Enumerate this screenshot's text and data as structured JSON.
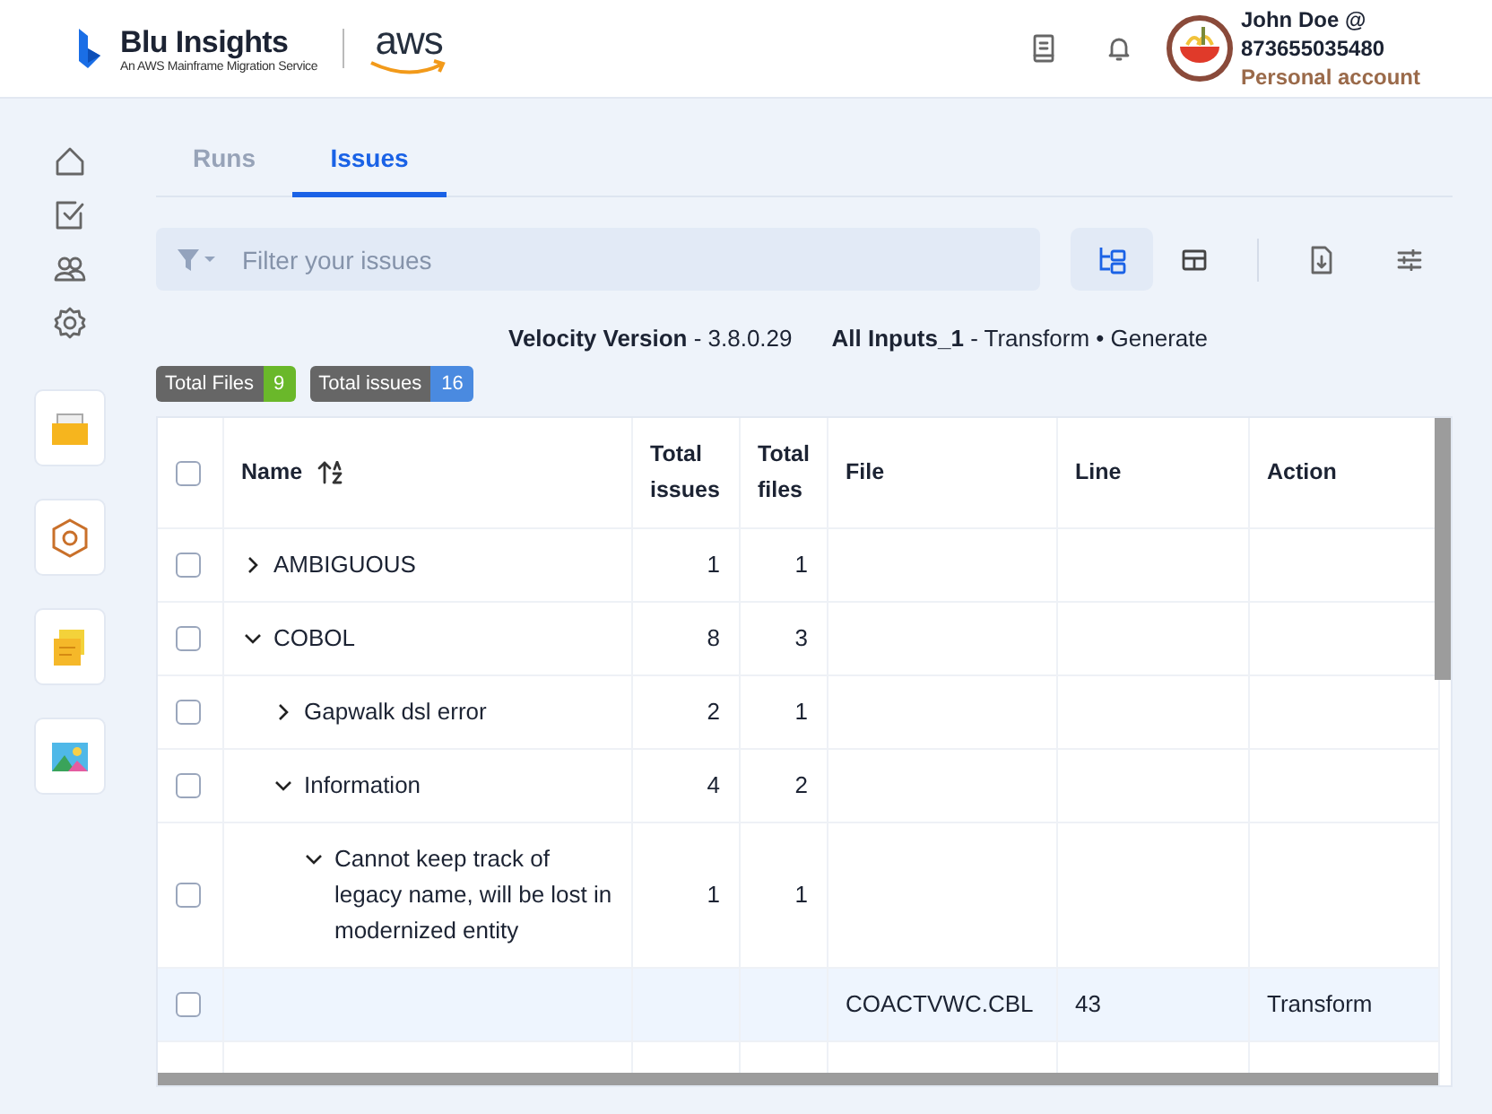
{
  "header": {
    "logo": {
      "name": "Blu Insights",
      "tagline": "An AWS Mainframe Migration Service",
      "partner": "aws"
    },
    "user": {
      "name": "John Doe @",
      "account_id": "873655035480",
      "account_type": "Personal account"
    }
  },
  "tabs": [
    {
      "label": "Runs",
      "selected": false
    },
    {
      "label": "Issues",
      "selected": true
    }
  ],
  "filter": {
    "placeholder": "Filter your issues"
  },
  "view_toggle": [
    {
      "kind": "tree",
      "selected": true
    },
    {
      "kind": "table",
      "selected": false
    }
  ],
  "summary": [
    "**Velocity Version** - 3.8.0.29",
    "**All Inputs_1** - Transform • Generate"
  ],
  "badges": [
    {
      "label": "Total Files",
      "count": "9",
      "color": "#6ab82a"
    },
    {
      "label": "Total issues",
      "count": "16",
      "color": "#4a8ae0"
    }
  ],
  "table": {
    "columns": [
      "Name",
      "Total issues",
      "Total files",
      "File",
      "Line",
      "Action"
    ],
    "header_checked": false,
    "rows": [
      {
        "name": "AMBIGUOUS",
        "total_issues": "1",
        "total_files": "1",
        "expanded": false,
        "checked": false,
        "selected": false
      },
      {
        "name": "COBOL",
        "total_issues": "8",
        "total_files": "3",
        "expanded": true,
        "checked": false,
        "selected": false,
        "children": [
          {
            "name": "Gapwalk dsl error",
            "total_issues": "2",
            "total_files": "1",
            "expanded": false,
            "checked": false,
            "selected": false
          },
          {
            "name": "Information",
            "total_issues": "4",
            "total_files": "2",
            "expanded": true,
            "checked": false,
            "selected": false,
            "children": [
              {
                "name": "Cannot keep track of legacy name, will be lost in modernized entity",
                "total_issues": "1",
                "total_files": "1",
                "expanded": true,
                "checked": false,
                "selected": false,
                "children": [
                  {
                    "file": "COACTVWC.CBL",
                    "line": "43",
                    "action": "Transform",
                    "checked": false,
                    "selected": true
                  }
                ]
              }
            ]
          }
        ]
      }
    ]
  }
}
